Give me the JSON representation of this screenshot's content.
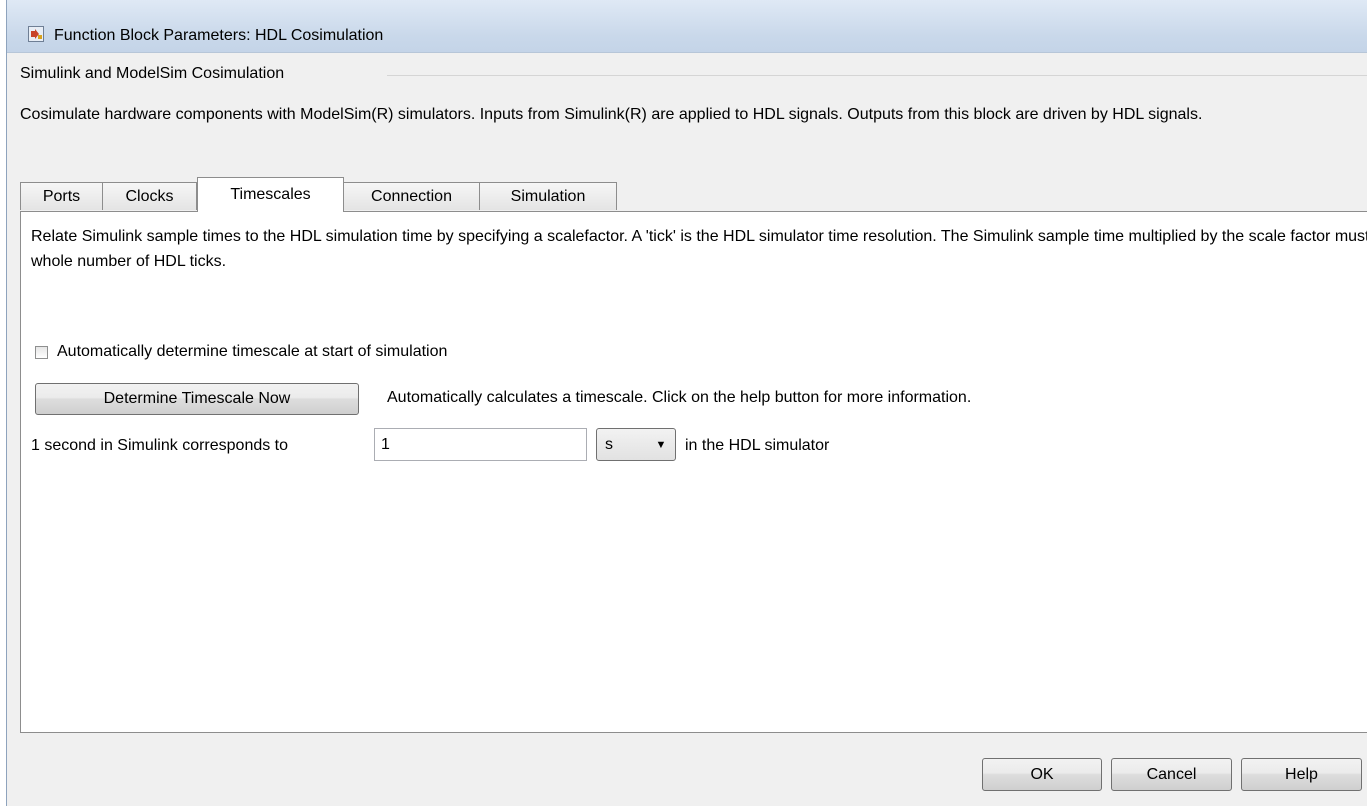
{
  "window": {
    "title": "Function Block Parameters: HDL Cosimulation"
  },
  "group": {
    "title": "Simulink and ModelSim Cosimulation",
    "description": "Cosimulate hardware components with ModelSim(R) simulators. Inputs from Simulink(R) are applied to HDL signals. Outputs from this block are driven by HDL signals."
  },
  "tabs": [
    {
      "label": "Ports",
      "active": false
    },
    {
      "label": "Clocks",
      "active": false
    },
    {
      "label": "Timescales",
      "active": true
    },
    {
      "label": "Connection",
      "active": false
    },
    {
      "label": "Simulation",
      "active": false
    }
  ],
  "timescales": {
    "description": "Relate Simulink sample times to the HDL simulation time by specifying a scalefactor. A 'tick' is the HDL simulator time resolution. The Simulink sample time multiplied by the scale factor must be a whole number of HDL ticks.",
    "auto_checkbox_label": "Automatically determine timescale at start of simulation",
    "auto_checked": false,
    "determine_button": "Determine Timescale Now",
    "determine_note": "Automatically calculates a timescale. Click on the help button for more information.",
    "scale_label": "1 second in Simulink corresponds to",
    "scale_value": "1",
    "unit_value": "s",
    "scale_suffix": "in the HDL simulator"
  },
  "buttons": {
    "ok": "OK",
    "cancel": "Cancel",
    "help": "Help"
  },
  "icons": {
    "app_icon": "simulink-block-icon",
    "dropdown_arrow": "▼"
  }
}
